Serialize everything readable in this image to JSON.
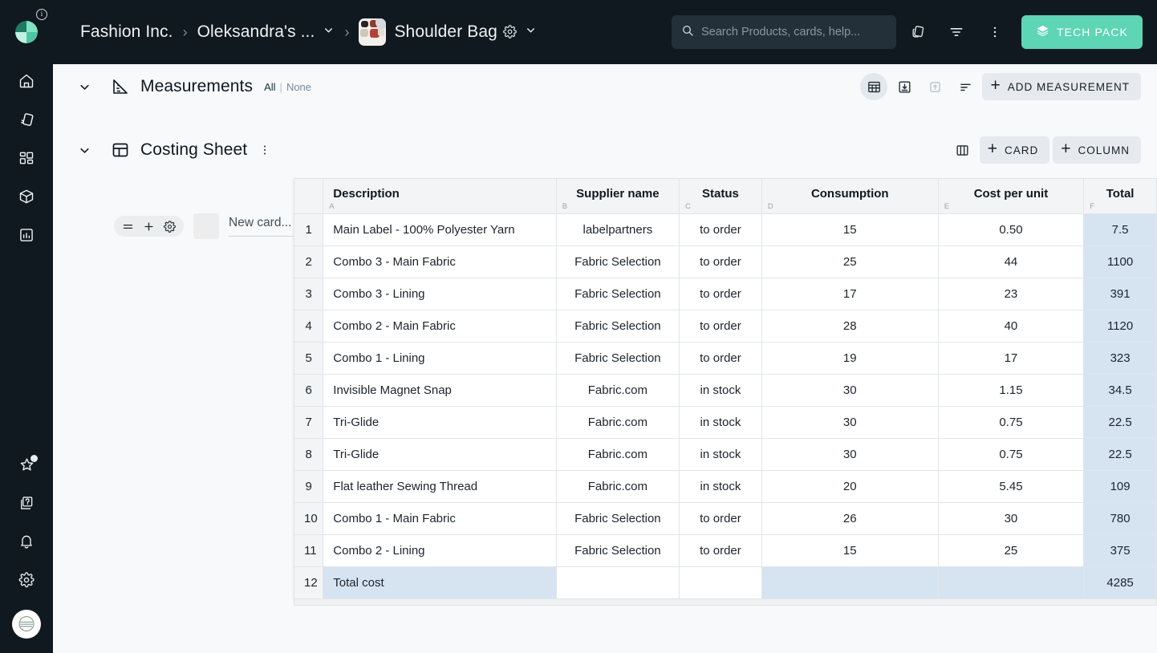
{
  "brand": {
    "logo_name": "pinwheel-logo",
    "accent_teal": "#5ED5B4",
    "dark_bg": "#10191F",
    "highlight_blue": "#d6e4f2"
  },
  "topbar": {
    "breadcrumbs": [
      {
        "label": "Fashion Inc.",
        "has_caret": false
      },
      {
        "label": "Oleksandra's ...",
        "has_caret": true
      },
      {
        "label": "Shoulder Bag",
        "has_caret": true,
        "has_gear": true,
        "has_thumb": true
      }
    ],
    "separator": "›",
    "search": {
      "placeholder": "Search Products, cards, help...",
      "value": ""
    },
    "icons": [
      "copy-icon",
      "filter-icon",
      "more-vertical-icon"
    ],
    "tech_pack_label": "TECH PACK"
  },
  "rail": {
    "items": [
      {
        "name": "home-icon"
      },
      {
        "name": "fabric-icon"
      },
      {
        "name": "grid-apps-icon"
      },
      {
        "name": "box-icon"
      },
      {
        "name": "chart-icon"
      }
    ],
    "bottom_items": [
      {
        "name": "star-icon",
        "has_dot": true
      },
      {
        "name": "help-cards-icon"
      },
      {
        "name": "bell-icon"
      },
      {
        "name": "gear-icon"
      }
    ],
    "avatar_name": "user-avatar"
  },
  "measurements": {
    "title": "Measurements",
    "icon": "ruler-triangle-icon",
    "select_all_label": "All",
    "select_divider": "|",
    "select_none_label": "None",
    "actions": [
      {
        "name": "grid-view-icon",
        "active": true
      },
      {
        "name": "import-icon",
        "active": false
      },
      {
        "name": "export-icon",
        "active": false,
        "dim": true
      },
      {
        "name": "sort-icon",
        "active": false
      }
    ],
    "add_button_label": "ADD MEASUREMENT"
  },
  "costing": {
    "title": "Costing Sheet",
    "icon": "table-layout-icon",
    "more_icon": "more-vertical-icon",
    "columns_icon": "columns-icon",
    "add_card_label": "CARD",
    "add_column_label": "COLUMN"
  },
  "card_stub": {
    "tools": [
      "drag-handle-icon",
      "plus-icon",
      "gear-icon"
    ],
    "placeholder": "New card..."
  },
  "sheet": {
    "columns": [
      {
        "label": "Description",
        "letter": "A",
        "cls": "c-desc"
      },
      {
        "label": "Supplier name",
        "letter": "B",
        "cls": "c-supp"
      },
      {
        "label": "Status",
        "letter": "C",
        "cls": "c-stat"
      },
      {
        "label": "Consumption",
        "letter": "D",
        "cls": "c-cons"
      },
      {
        "label": "Cost per unit",
        "letter": "E",
        "cls": "c-cost"
      },
      {
        "label": "Total",
        "letter": "F",
        "cls": "c-total"
      }
    ],
    "rows": [
      {
        "n": "1",
        "description": "Main Label - 100% Polyester Yarn",
        "supplier": "labelpartners",
        "status": "to order",
        "consumption": "15",
        "cost": "0.50",
        "total": "7.5"
      },
      {
        "n": "2",
        "description": "Combo 3 - Main Fabric",
        "supplier": "Fabric Selection",
        "status": "to order",
        "consumption": "25",
        "cost": "44",
        "total": "1100"
      },
      {
        "n": "3",
        "description": "Combo 3 - Lining",
        "supplier": "Fabric Selection",
        "status": "to order",
        "consumption": "17",
        "cost": "23",
        "total": "391"
      },
      {
        "n": "4",
        "description": "Combo 2 - Main Fabric",
        "supplier": "Fabric Selection",
        "status": "to order",
        "consumption": "28",
        "cost": "40",
        "total": "1120"
      },
      {
        "n": "5",
        "description": "Combo 1 - Lining",
        "supplier": "Fabric Selection",
        "status": "to order",
        "consumption": "19",
        "cost": "17",
        "total": "323"
      },
      {
        "n": "6",
        "description": "Invisible Magnet Snap",
        "supplier": "Fabric.com",
        "status": "in stock",
        "consumption": "30",
        "cost": "1.15",
        "total": "34.5"
      },
      {
        "n": "7",
        "description": "Tri-Glide",
        "supplier": "Fabric.com",
        "status": "in stock",
        "consumption": "30",
        "cost": "0.75",
        "total": "22.5"
      },
      {
        "n": "8",
        "description": "Tri-Glide",
        "supplier": "Fabric.com",
        "status": "in stock",
        "consumption": "30",
        "cost": "0.75",
        "total": "22.5"
      },
      {
        "n": "9",
        "description": "Flat leather Sewing Thread",
        "supplier": "Fabric.com",
        "status": "in stock",
        "consumption": "20",
        "cost": "5.45",
        "total": "109"
      },
      {
        "n": "10",
        "description": "Combo 1 - Main Fabric",
        "supplier": "Fabric Selection",
        "status": "to order",
        "consumption": "26",
        "cost": "30",
        "total": "780"
      },
      {
        "n": "11",
        "description": "Combo 2 - Lining",
        "supplier": "Fabric Selection",
        "status": "to order",
        "consumption": "15",
        "cost": "25",
        "total": "375"
      }
    ],
    "total_row": {
      "n": "12",
      "description": "Total cost",
      "supplier": "",
      "status": "",
      "consumption": "",
      "cost": "",
      "total": "4285"
    }
  }
}
